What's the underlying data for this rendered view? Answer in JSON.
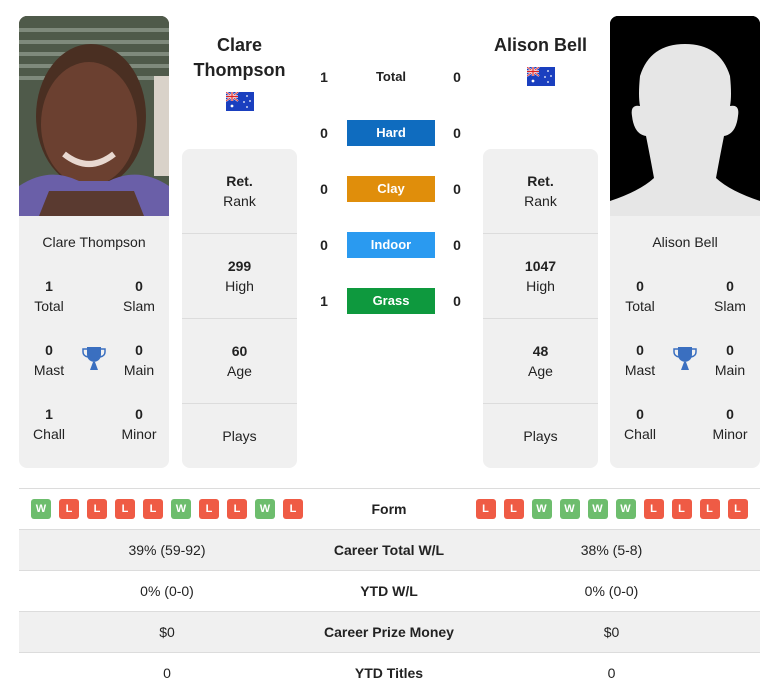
{
  "colors": {
    "hard": "#0f6cbf",
    "clay": "#e08e0b",
    "indoor": "#2a9af0",
    "grass": "#0e993e",
    "win": "#6dbd6d",
    "loss": "#ef5b45",
    "trophy": "#3a6fc0"
  },
  "player1": {
    "name_line1": "Clare",
    "name_line2": "Thompson",
    "full_name": "Clare Thompson",
    "flag": "australia-flag",
    "titles": {
      "total": {
        "value": "1",
        "label": "Total"
      },
      "slam": {
        "value": "0",
        "label": "Slam"
      },
      "mast": {
        "value": "0",
        "label": "Mast"
      },
      "main": {
        "value": "0",
        "label": "Main"
      },
      "chall": {
        "value": "1",
        "label": "Chall"
      },
      "minor": {
        "value": "0",
        "label": "Minor"
      }
    },
    "info": {
      "rank": {
        "value": "Ret.",
        "label": "Rank"
      },
      "high": {
        "value": "299",
        "label": "High"
      },
      "age": {
        "value": "60",
        "label": "Age"
      },
      "plays": {
        "value": "",
        "label": "Plays"
      }
    },
    "form": [
      "W",
      "L",
      "L",
      "L",
      "L",
      "W",
      "L",
      "L",
      "W",
      "L"
    ],
    "career_total_wl": "39% (59-92)",
    "ytd_wl": "0% (0-0)",
    "career_prize_money": "$0",
    "ytd_titles": "0"
  },
  "player2": {
    "name": "Alison Bell",
    "full_name": "Alison Bell",
    "flag": "australia-flag",
    "titles": {
      "total": {
        "value": "0",
        "label": "Total"
      },
      "slam": {
        "value": "0",
        "label": "Slam"
      },
      "mast": {
        "value": "0",
        "label": "Mast"
      },
      "main": {
        "value": "0",
        "label": "Main"
      },
      "chall": {
        "value": "0",
        "label": "Chall"
      },
      "minor": {
        "value": "0",
        "label": "Minor"
      }
    },
    "info": {
      "rank": {
        "value": "Ret.",
        "label": "Rank"
      },
      "high": {
        "value": "1047",
        "label": "High"
      },
      "age": {
        "value": "48",
        "label": "Age"
      },
      "plays": {
        "value": "",
        "label": "Plays"
      }
    },
    "form": [
      "L",
      "L",
      "W",
      "W",
      "W",
      "W",
      "L",
      "L",
      "L",
      "L"
    ],
    "career_total_wl": "38% (5-8)",
    "ytd_wl": "0% (0-0)",
    "career_prize_money": "$0",
    "ytd_titles": "0"
  },
  "h2h": [
    {
      "label": "Total",
      "p1": "1",
      "p2": "0"
    },
    {
      "label": "Hard",
      "p1": "0",
      "p2": "0"
    },
    {
      "label": "Clay",
      "p1": "0",
      "p2": "0"
    },
    {
      "label": "Indoor",
      "p1": "0",
      "p2": "0"
    },
    {
      "label": "Grass",
      "p1": "1",
      "p2": "0"
    }
  ],
  "table_labels": {
    "form": "Form",
    "career_total_wl": "Career Total W/L",
    "ytd_wl": "YTD W/L",
    "career_prize_money": "Career Prize Money",
    "ytd_titles": "YTD Titles"
  }
}
